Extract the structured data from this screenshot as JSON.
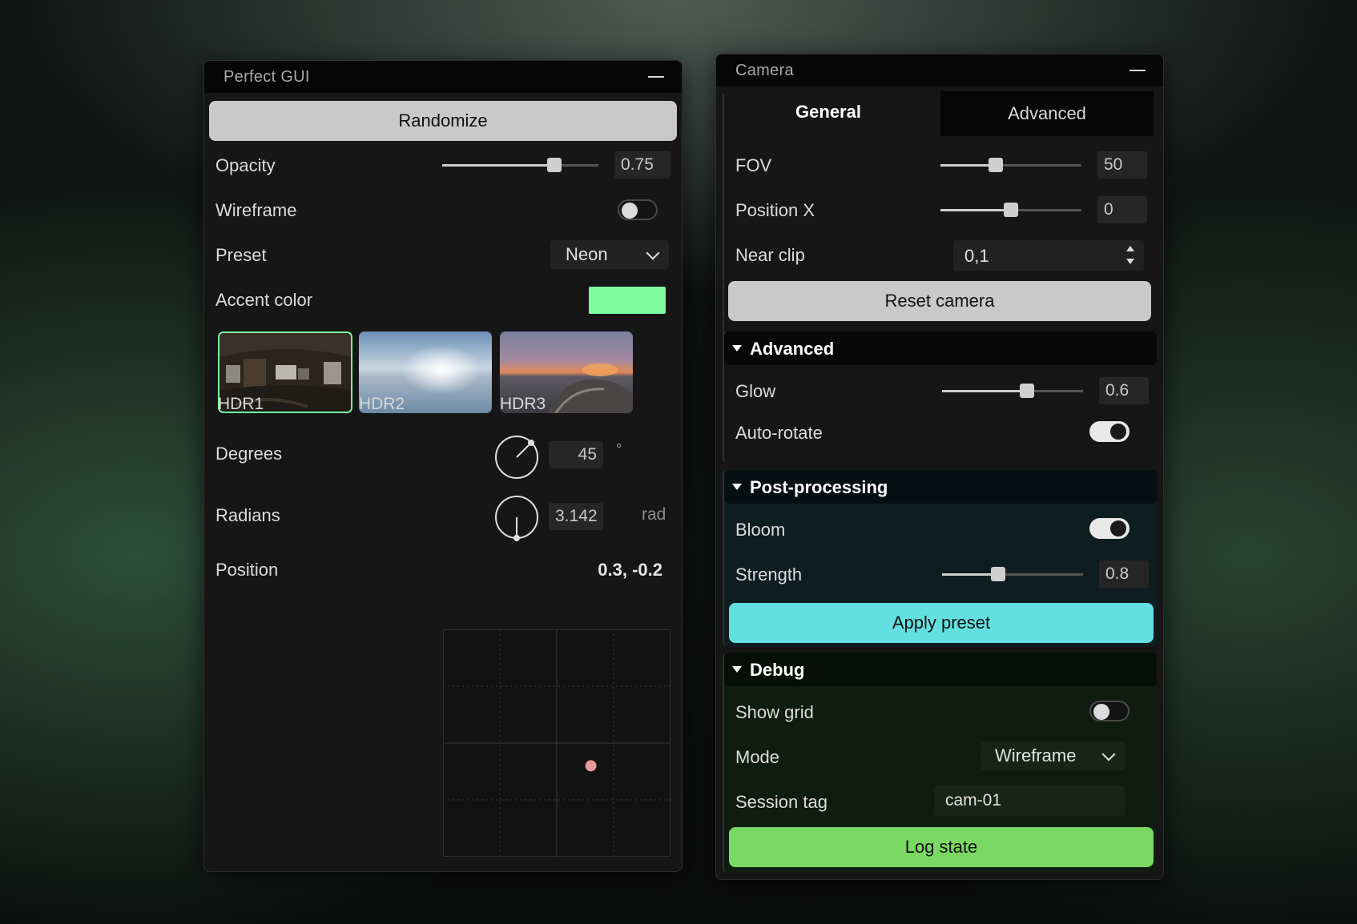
{
  "left_panel": {
    "title": "Perfect GUI",
    "randomize_label": "Randomize",
    "opacity": {
      "label": "Opacity",
      "value": "0.75",
      "fraction": 0.72
    },
    "wireframe": {
      "label": "Wireframe",
      "on": false
    },
    "preset": {
      "label": "Preset",
      "value": "Neon"
    },
    "accent": {
      "label": "Accent color",
      "color": "#7dfc9e"
    },
    "hdr_items": [
      {
        "label": "HDR1",
        "selected": true
      },
      {
        "label": "HDR2",
        "selected": false
      },
      {
        "label": "HDR3",
        "selected": false
      }
    ],
    "degrees": {
      "label": "Degrees",
      "value": "45",
      "unit": "°"
    },
    "radians": {
      "label": "Radians",
      "value": "3.142",
      "unit": "rad"
    },
    "position": {
      "label": "Position",
      "value": "0.3, -0.2"
    }
  },
  "camera_panel": {
    "title": "Camera",
    "tabs": {
      "general": "General",
      "advanced": "Advanced"
    },
    "fov": {
      "label": "FOV",
      "value": "50",
      "fraction": 0.39
    },
    "position_x": {
      "label": "Position X",
      "value": "0",
      "fraction": 0.5
    },
    "near_clip": {
      "label": "Near clip",
      "value": "0,1"
    },
    "reset_label": "Reset camera",
    "advanced_section": {
      "title": "Advanced",
      "glow": {
        "label": "Glow",
        "value": "0.6",
        "fraction": 0.6
      },
      "auto_rotate": {
        "label": "Auto-rotate",
        "on": true
      }
    },
    "post_section": {
      "title": "Post-processing",
      "bloom": {
        "label": "Bloom",
        "on": true
      },
      "strength": {
        "label": "Strength",
        "value": "0.8",
        "fraction": 0.4
      },
      "apply_label": "Apply preset"
    },
    "debug_section": {
      "title": "Debug",
      "show_grid": {
        "label": "Show grid",
        "on": false
      },
      "mode": {
        "label": "Mode",
        "value": "Wireframe"
      },
      "session_tag": {
        "label": "Session tag",
        "value": "cam-01"
      },
      "log_label": "Log state"
    }
  },
  "colors": {
    "apply_button": "#63dfe0",
    "log_button": "#7ad963",
    "post_bg": "#0e1e20",
    "debug_bg": "#0f1c10",
    "xy_dot": "#e79a9a"
  }
}
